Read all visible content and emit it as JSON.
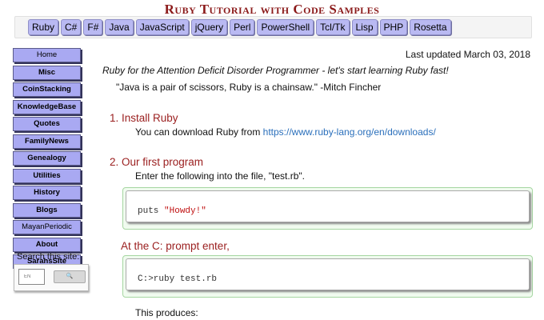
{
  "site": {
    "title": "Ruby Tutorial with Code Samples"
  },
  "lang_tabs": [
    "Ruby",
    "C#",
    "F#",
    "Java",
    "JavaScript",
    "jQuery",
    "Perl",
    "PowerShell",
    "Tcl/Tk",
    "Lisp",
    "PHP",
    "Rosetta"
  ],
  "sidebar": {
    "items": [
      {
        "label": "Home",
        "bold": false
      },
      {
        "label": "Misc",
        "bold": true
      },
      {
        "label": "CoinStacking",
        "bold": true
      },
      {
        "label": "KnowledgeBase",
        "bold": true
      },
      {
        "label": "Quotes",
        "bold": true
      },
      {
        "label": "FamilyNews",
        "bold": true
      },
      {
        "label": "Genealogy",
        "bold": true
      },
      {
        "label": "Utilities",
        "bold": true
      },
      {
        "label": "History",
        "bold": true
      },
      {
        "label": "Blogs",
        "bold": true
      },
      {
        "label": "MayanPeriodic",
        "bold": false
      },
      {
        "label": "About",
        "bold": true
      },
      {
        "label": "SarahsSite",
        "bold": true
      }
    ],
    "search_label": "Search this site:",
    "search_placeholder": "EN",
    "search_button": "🔍"
  },
  "main": {
    "last_updated": "Last updated March 03, 2018",
    "tagline": "Ruby for the Attention Deficit Disorder Programmer - let's start learning Ruby fast!",
    "quote": "\"Java is a pair of scissors, Ruby is a chainsaw.\" -Mitch Fincher",
    "section1": {
      "heading": "1. Install Ruby",
      "text": "You can download Ruby from ",
      "link": "https://www.ruby-lang.org/en/downloads/"
    },
    "section2": {
      "heading": "2. Our first program",
      "text": "Enter the following into the file, \"test.rb\".",
      "code1_kw": "puts ",
      "code1_str": "\"Howdy!\"",
      "subheading": "At the C: prompt enter,",
      "code2": "C:>ruby test.rb",
      "produces": "This produces:"
    }
  }
}
